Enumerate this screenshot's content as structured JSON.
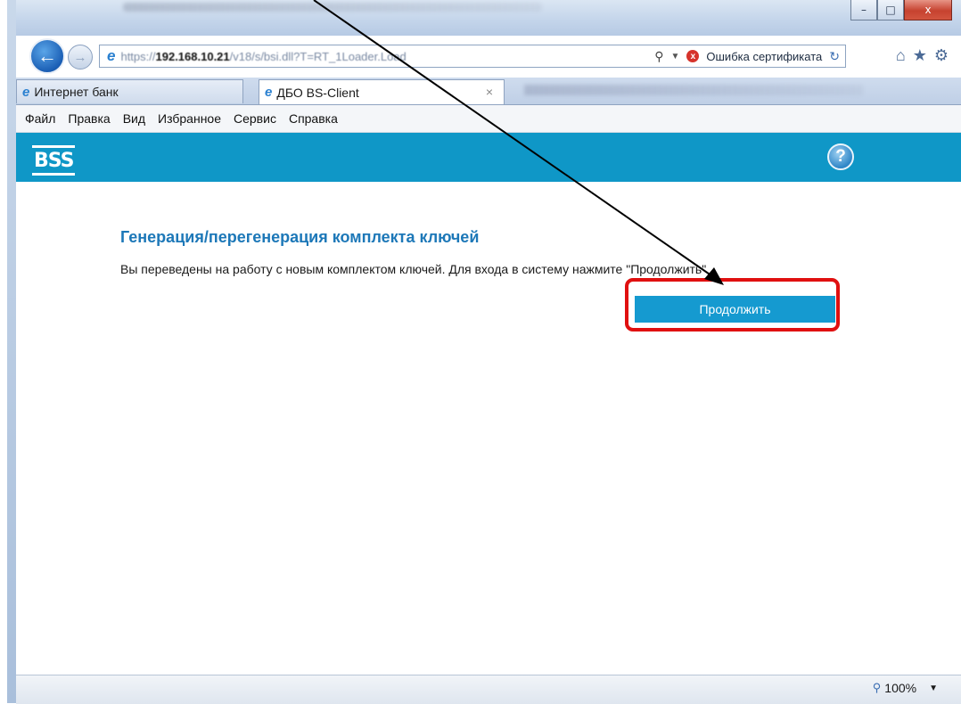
{
  "browser": {
    "url_scheme": "https://",
    "url_host": "192.168.10.21",
    "url_path": "/v18/s/bsi.dll?T=RT_1Loader.Load",
    "cert_error": "Ошибка сертификата",
    "window_buttons": [
      "–",
      "□",
      "x"
    ]
  },
  "tabs": [
    {
      "label": "Интернет банк",
      "active": false
    },
    {
      "label": "ДБО BS-Client",
      "active": true,
      "close": "×"
    }
  ],
  "menu": [
    "Файл",
    "Правка",
    "Вид",
    "Избранное",
    "Сервис",
    "Справка"
  ],
  "header": {
    "logo": "BSS",
    "help": "?",
    "band_color": "#0f97c7"
  },
  "main": {
    "heading": "Генерация/перегенерация комплекта ключей",
    "message": "Вы переведены на работу с новым комплектом ключей. Для входа в систему нажмите \"Продолжить\".",
    "continue_label": "Продолжить"
  },
  "status": {
    "zoom": "100%"
  },
  "colors": {
    "accent": "#159ad0",
    "heading": "#1d78b8",
    "highlight": "#e01010"
  }
}
